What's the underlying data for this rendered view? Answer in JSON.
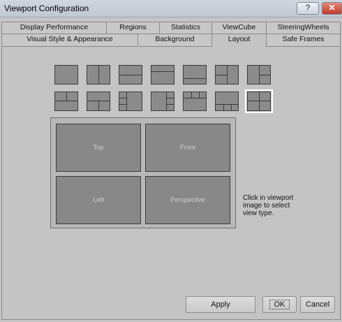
{
  "window": {
    "title": "Viewport Configuration",
    "help_label": "?",
    "close_label": "✕"
  },
  "tabs_row1": [
    {
      "label": "Display Performance"
    },
    {
      "label": "Regions"
    },
    {
      "label": "Statistics"
    },
    {
      "label": "ViewCube"
    },
    {
      "label": "SteeringWheels"
    }
  ],
  "tabs_row2": [
    {
      "label": "Visual Style & Appearance"
    },
    {
      "label": "Background"
    },
    {
      "label": "Layout",
      "active": true
    },
    {
      "label": "Safe Frames"
    }
  ],
  "layout": {
    "selected_index": 13,
    "preview_viewports": [
      {
        "label": "Top"
      },
      {
        "label": "Front"
      },
      {
        "label": "Left"
      },
      {
        "label": "Perspective"
      }
    ],
    "hint": "Click in viewport image to select view type."
  },
  "buttons": {
    "apply": "Apply",
    "ok": "OK",
    "cancel": "Cancel"
  },
  "colors": {
    "panel": "#c4c4c4",
    "pane": "#8b8b8b",
    "selection": "#ffffff"
  }
}
